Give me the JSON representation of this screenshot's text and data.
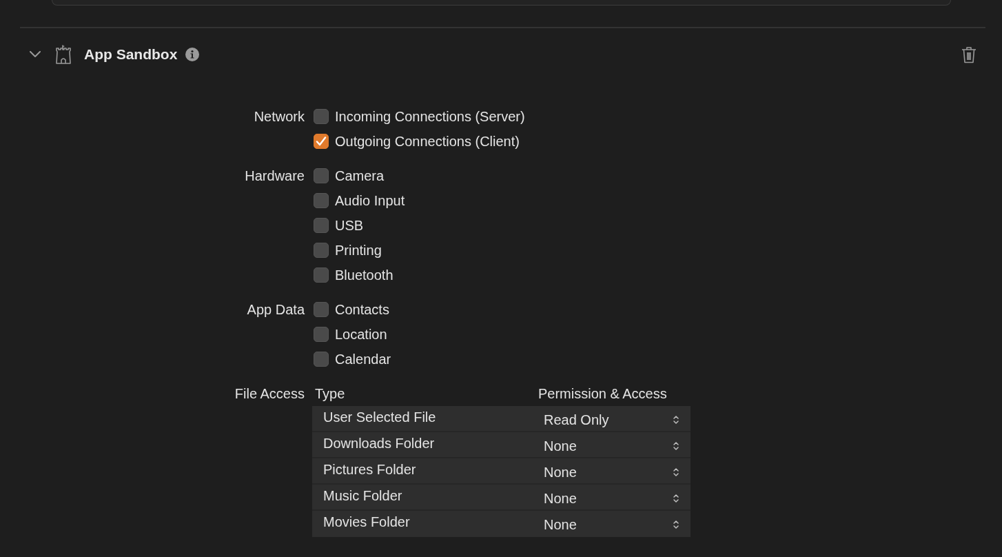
{
  "section": {
    "title": "App Sandbox",
    "expanded": true
  },
  "groups": [
    {
      "label": "Network",
      "options": [
        {
          "label": "Incoming Connections (Server)",
          "checked": false
        },
        {
          "label": "Outgoing Connections (Client)",
          "checked": true
        }
      ]
    },
    {
      "label": "Hardware",
      "options": [
        {
          "label": "Camera",
          "checked": false
        },
        {
          "label": "Audio Input",
          "checked": false
        },
        {
          "label": "USB",
          "checked": false
        },
        {
          "label": "Printing",
          "checked": false
        },
        {
          "label": "Bluetooth",
          "checked": false
        }
      ]
    },
    {
      "label": "App Data",
      "options": [
        {
          "label": "Contacts",
          "checked": false
        },
        {
          "label": "Location",
          "checked": false
        },
        {
          "label": "Calendar",
          "checked": false
        }
      ]
    }
  ],
  "file_access": {
    "label": "File Access",
    "columns": [
      "Type",
      "Permission & Access"
    ],
    "rows": [
      {
        "type": "User Selected File",
        "permission": "Read Only"
      },
      {
        "type": "Downloads Folder",
        "permission": "None"
      },
      {
        "type": "Pictures Folder",
        "permission": "None"
      },
      {
        "type": "Music Folder",
        "permission": "None"
      },
      {
        "type": "Movies Folder",
        "permission": "None"
      }
    ]
  }
}
